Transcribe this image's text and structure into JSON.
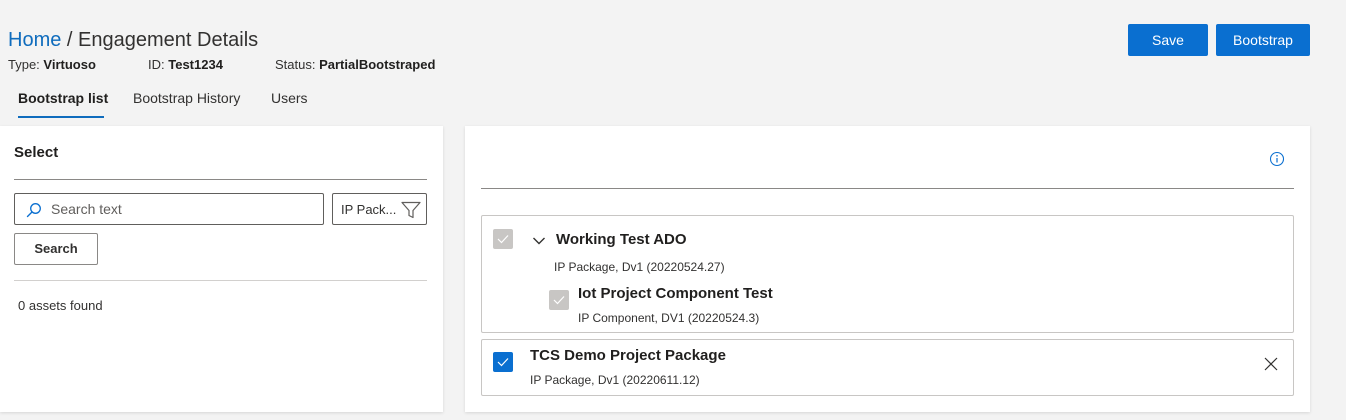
{
  "header": {
    "breadcrumb_home": "Home",
    "breadcrumb_sep": " / ",
    "breadcrumb_current": "Engagement Details",
    "type_label": "Type:",
    "type_value": "Virtuoso",
    "id_label": "ID:",
    "id_value": "Test1234",
    "status_label": "Status:",
    "status_value": "PartialBootstraped",
    "save_label": "Save",
    "bootstrap_label": "Bootstrap"
  },
  "tabs": [
    {
      "label": "Bootstrap list",
      "active": true
    },
    {
      "label": "Bootstrap History",
      "active": false
    },
    {
      "label": "Users",
      "active": false
    }
  ],
  "left_panel": {
    "title": "Select",
    "search_placeholder": "Search text",
    "filter_value": "IP Pack...",
    "search_button": "Search",
    "assets_found": "0 assets found"
  },
  "right_panel": {
    "items": [
      {
        "title": "Working Test ADO",
        "subtitle": "IP Package, Dv1 (20220524.27)",
        "checked": true,
        "disabled": true,
        "expanded": true,
        "children": [
          {
            "title": "Iot Project Component Test",
            "subtitle": "IP Component, DV1 (20220524.3)",
            "checked": true,
            "disabled": true
          }
        ]
      },
      {
        "title": "TCS Demo Project Package",
        "subtitle": "IP Package, Dv1 (20220611.12)",
        "checked": true,
        "disabled": false
      }
    ]
  },
  "colors": {
    "primary": "#0a6fd0",
    "link": "#0f6cbd",
    "disabled_check": "#c8c6c4"
  }
}
